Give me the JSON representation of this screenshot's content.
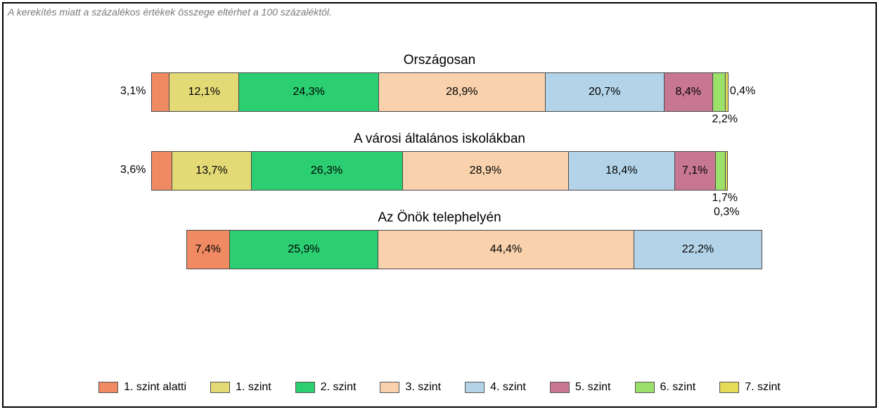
{
  "note": "A kerekítés miatt a százalékos értékek összege eltérhet a 100 százaléktól.",
  "colors": {
    "c0": "#f08a63",
    "c1": "#e3da76",
    "c2": "#2bcf72",
    "c3": "#f9d2ad",
    "c4": "#b3d4e8",
    "c5": "#c77792",
    "c6": "#9be069",
    "c7": "#e6db57"
  },
  "legend": [
    {
      "label": "1. szint alatti",
      "color": "c0"
    },
    {
      "label": "1. szint",
      "color": "c1"
    },
    {
      "label": "2. szint",
      "color": "c2"
    },
    {
      "label": "3. szint",
      "color": "c3"
    },
    {
      "label": "4. szint",
      "color": "c4"
    },
    {
      "label": "5. szint",
      "color": "c5"
    },
    {
      "label": "6. szint",
      "color": "c6"
    },
    {
      "label": "7. szint",
      "color": "c7"
    }
  ],
  "rows": [
    {
      "title": "Országosan",
      "segments": [
        {
          "v": 3.1,
          "label": "3,1%",
          "color": "c0",
          "out": "left"
        },
        {
          "v": 12.1,
          "label": "12,1%",
          "color": "c1"
        },
        {
          "v": 24.3,
          "label": "24,3%",
          "color": "c2"
        },
        {
          "v": 28.9,
          "label": "28,9%",
          "color": "c3"
        },
        {
          "v": 20.7,
          "label": "20,7%",
          "color": "c4"
        },
        {
          "v": 8.4,
          "label": "8,4%",
          "color": "c5"
        },
        {
          "v": 2.2,
          "label": "2,2%",
          "color": "c6",
          "out": "below-right"
        },
        {
          "v": 0.4,
          "label": "0,4%",
          "color": "c7",
          "out": "right"
        }
      ]
    },
    {
      "title": "A városi általános iskolákban",
      "segments": [
        {
          "v": 3.6,
          "label": "3,6%",
          "color": "c0",
          "out": "left"
        },
        {
          "v": 13.7,
          "label": "13,7%",
          "color": "c1"
        },
        {
          "v": 26.3,
          "label": "26,3%",
          "color": "c2"
        },
        {
          "v": 28.9,
          "label": "28,9%",
          "color": "c3"
        },
        {
          "v": 18.4,
          "label": "18,4%",
          "color": "c4"
        },
        {
          "v": 7.1,
          "label": "7,1%",
          "color": "c5"
        },
        {
          "v": 1.7,
          "label": "1,7%",
          "color": "c6",
          "out": "below-right"
        },
        {
          "v": 0.3,
          "label": "0,3%",
          "color": "c7",
          "out": "below-right2"
        }
      ]
    },
    {
      "title": "Az Önök telephelyén",
      "offset": 50,
      "segments": [
        {
          "v": 7.4,
          "label": "7,4%",
          "color": "c0"
        },
        {
          "v": 25.9,
          "label": "25,9%",
          "color": "c2"
        },
        {
          "v": 44.4,
          "label": "44,4%",
          "color": "c3"
        },
        {
          "v": 22.2,
          "label": "22,2%",
          "color": "c4"
        }
      ]
    }
  ],
  "chart_data": {
    "type": "bar",
    "stacked": true,
    "orientation": "horizontal",
    "categories": [
      "Országosan",
      "A városi általános iskolákban",
      "Az Önök telephelyén"
    ],
    "series": [
      {
        "name": "1. szint alatti",
        "values": [
          3.1,
          3.6,
          7.4
        ]
      },
      {
        "name": "1. szint",
        "values": [
          12.1,
          13.7,
          0
        ]
      },
      {
        "name": "2. szint",
        "values": [
          24.3,
          26.3,
          25.9
        ]
      },
      {
        "name": "3. szint",
        "values": [
          28.9,
          28.9,
          44.4
        ]
      },
      {
        "name": "4. szint",
        "values": [
          20.7,
          18.4,
          22.2
        ]
      },
      {
        "name": "5. szint",
        "values": [
          8.4,
          7.1,
          0
        ]
      },
      {
        "name": "6. szint",
        "values": [
          2.2,
          1.7,
          0
        ]
      },
      {
        "name": "7. szint",
        "values": [
          0.4,
          0.3,
          0
        ]
      }
    ],
    "unit": "%",
    "xlim": [
      0,
      100
    ]
  }
}
